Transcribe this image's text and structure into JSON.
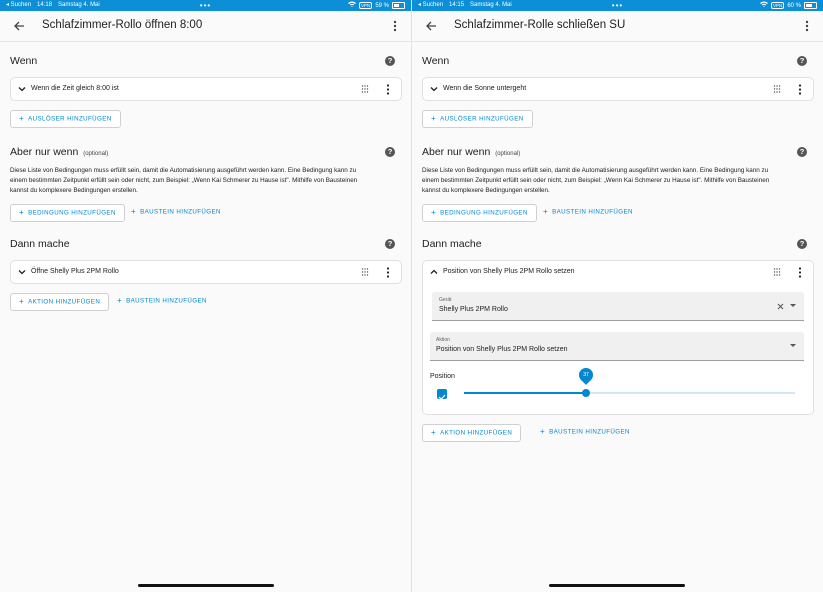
{
  "left": {
    "status": {
      "back": "◂ Suchen",
      "time": "14:18",
      "date": "Samstag 4. Mai",
      "dots": "•••",
      "vpn": "VPN",
      "battery": "59 %",
      "battery_level": 0.59
    },
    "title": "Schlafzimmer-Rollo öffnen 8:00",
    "when": {
      "heading": "Wenn",
      "trigger": "Wenn die Zeit gleich 8:00 ist",
      "add": "Auslöser hinzufügen"
    },
    "cond": {
      "heading": "Aber nur wenn",
      "optional": "(optional)",
      "desc1": "Diese Liste von Bedingungen muss erfüllt sein, damit die Automatisierung ausgeführt werden kann. Eine Bedingung kann zu",
      "desc2": "einem bestimmten Zeitpunkt erfüllt sein oder nicht, zum Beispiel: „Wenn Kai Schmerer zu Hause ist\". Mithilfe von Bausteinen",
      "desc3": "kannst du komplexere Bedingungen erstellen.",
      "add": "Bedingung hinzufügen",
      "block": "Baustein hinzufügen"
    },
    "then": {
      "heading": "Dann mache",
      "action": "Öffne Shelly Plus 2PM Rollo",
      "add": "Aktion hinzufügen",
      "block": "Baustein hinzufügen"
    }
  },
  "right": {
    "status": {
      "back": "◂ Suchen",
      "time": "14:15",
      "date": "Samstag 4. Mai",
      "dots": "•••",
      "vpn": "VPN",
      "battery": "60 %",
      "battery_level": 0.6
    },
    "title": "Schlafzimmer-Rolle schließen SU",
    "when": {
      "heading": "Wenn",
      "trigger": "Wenn die Sonne untergeht",
      "add": "Auslöser hinzufügen"
    },
    "cond": {
      "heading": "Aber nur wenn",
      "optional": "(optional)",
      "desc1": "Diese Liste von Bedingungen muss erfüllt sein, damit die Automatisierung ausgeführt werden kann. Eine Bedingung kann zu",
      "desc2": "einem bestimmten Zeitpunkt erfüllt sein oder nicht, zum Beispiel: „Wenn Kai Schmerer zu Hause ist\". Mithilfe von Bausteinen",
      "desc3": "kannst du komplexere Bedingungen erstellen.",
      "add": "Bedingung hinzufügen",
      "block": "Baustein hinzufügen"
    },
    "then": {
      "heading": "Dann mache",
      "action": "Position von Shelly Plus 2PM Rollo setzen",
      "device_label": "Gerät",
      "device_value": "Shelly Plus 2PM Rollo",
      "service_label": "Aktion",
      "service_value": "Position von Shelly Plus 2PM Rollo setzen",
      "position_label": "Position",
      "position_value": "37",
      "add": "Aktion hinzufügen",
      "block": "Baustein hinzufügen"
    }
  },
  "colors": {
    "accent": "#0288d1",
    "statusbar": "#0c8fd6",
    "help": "#555555"
  }
}
